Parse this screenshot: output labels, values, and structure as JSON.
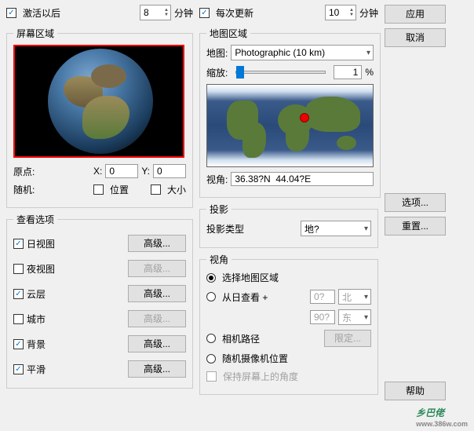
{
  "top": {
    "activate_after": {
      "label": "激活以后",
      "value": "8",
      "unit": "分钟"
    },
    "update_every": {
      "label": "每次更新",
      "value": "10",
      "unit": "分钟"
    }
  },
  "screen_region": {
    "legend": "屏幕区域",
    "origin_label": "原点:",
    "x_label": "X:",
    "x_val": "0",
    "y_label": "Y:",
    "y_val": "0",
    "random_label": "随机:",
    "position_label": "位置",
    "size_label": "大小"
  },
  "view_options": {
    "legend": "查看选项",
    "items": [
      {
        "label": "日视图",
        "checked": true,
        "btn": "高级...",
        "enabled": true
      },
      {
        "label": "夜视图",
        "checked": false,
        "btn": "高级...",
        "enabled": false
      },
      {
        "label": "云层",
        "checked": true,
        "btn": "高级...",
        "enabled": true
      },
      {
        "label": "城市",
        "checked": false,
        "btn": "高级...",
        "enabled": false
      },
      {
        "label": "背景",
        "checked": true,
        "btn": "高级...",
        "enabled": true
      },
      {
        "label": "平滑",
        "checked": true,
        "btn": "高级...",
        "enabled": true
      }
    ]
  },
  "map_region": {
    "legend": "地图区域",
    "map_label": "地图:",
    "map_value": "Photographic (10 km)",
    "zoom_label": "缩放:",
    "zoom_value": "1",
    "zoom_unit": "%",
    "angle_label": "视角:",
    "angle_value": "36.38?N  44.04?E"
  },
  "projection": {
    "legend": "投影",
    "type_label": "投影类型",
    "type_value": "地?"
  },
  "view_angle": {
    "legend": "视角",
    "opt_select_region": "选择地图区域",
    "opt_from_day": "从日查看 +",
    "from_val1": "0?",
    "from_dir1": "北",
    "from_val2": "90?",
    "from_dir2": "东",
    "opt_camera_path": "相机路径",
    "camera_btn": "限定...",
    "opt_random_cam": "随机摄像机位置",
    "keep_screen": "保持屏幕上的角度"
  },
  "side": {
    "apply": "应用",
    "cancel": "取消",
    "options": "选项...",
    "reset": "重置...",
    "help": "帮助"
  },
  "watermark": {
    "text": "乡巴佬",
    "url": "www.386w.com"
  }
}
